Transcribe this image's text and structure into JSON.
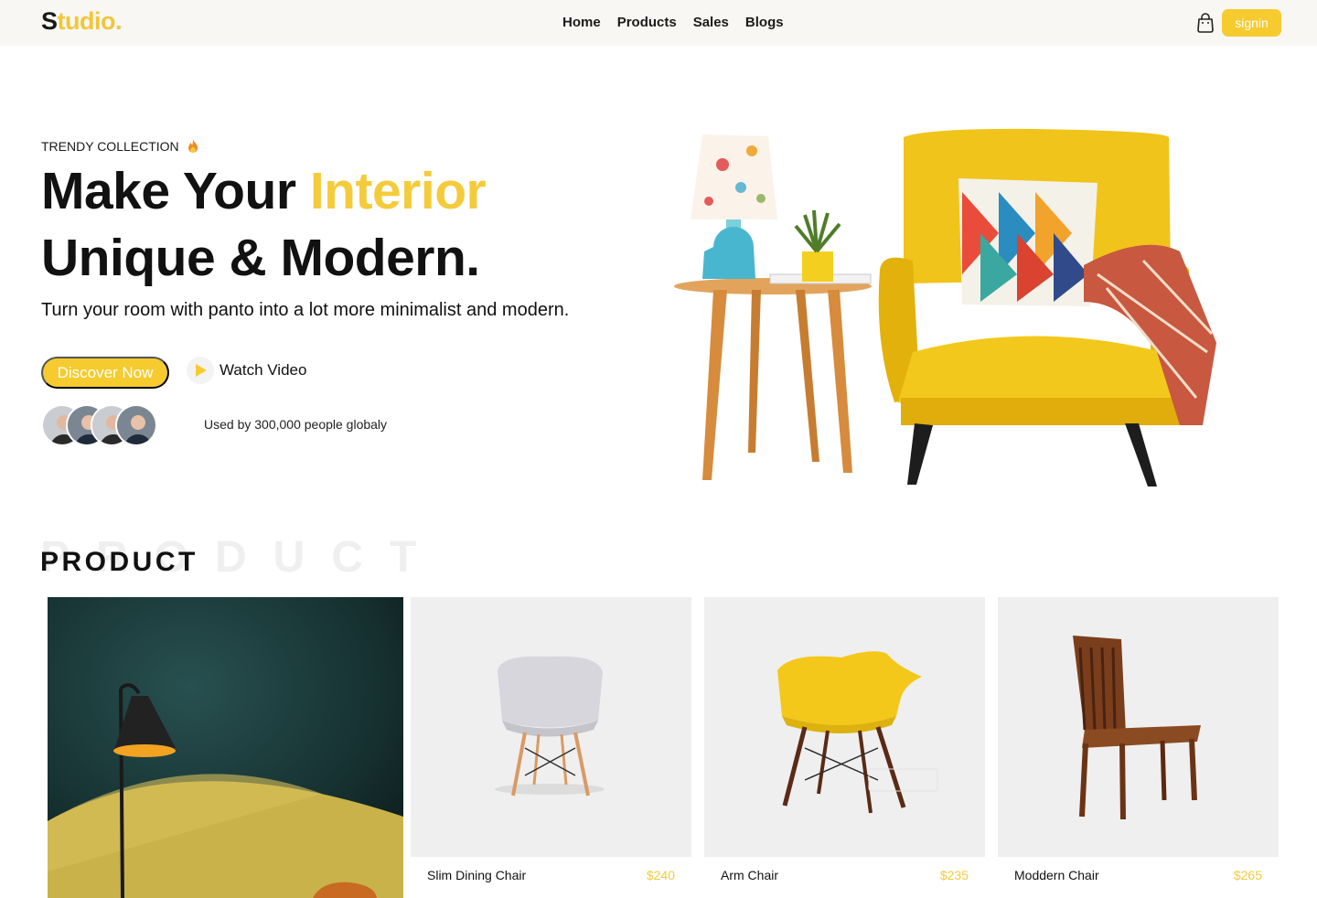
{
  "brand": {
    "first": "S",
    "rest": "tudio."
  },
  "nav": {
    "links": [
      "Home",
      "Products",
      "Sales",
      "Blogs"
    ],
    "signin_label": "signin"
  },
  "hero": {
    "eyebrow": "TRENDY COLLECTION",
    "title_line1_a": "Make Your ",
    "title_line1_b": "Interior",
    "title_line2": "Unique & Modern.",
    "subtitle": "Turn your room with panto into a lot more minimalist and modern.",
    "discover_label": "Discover Now",
    "watch_label": "Watch Video",
    "used_by": "Used by 300,000 people globaly"
  },
  "products_section": {
    "ghost": "PRODUCT",
    "title": "PRODUCT",
    "items": [
      {
        "name": "Slim Dining Chair",
        "price": "$240"
      },
      {
        "name": "Arm Chair",
        "price": "$235"
      },
      {
        "name": "Moddern Chair",
        "price": "$265"
      }
    ]
  },
  "colors": {
    "accent": "#f5cb2f",
    "dark": "#111111",
    "card_bg": "#efefef",
    "nav_bg": "#f8f7f3"
  }
}
